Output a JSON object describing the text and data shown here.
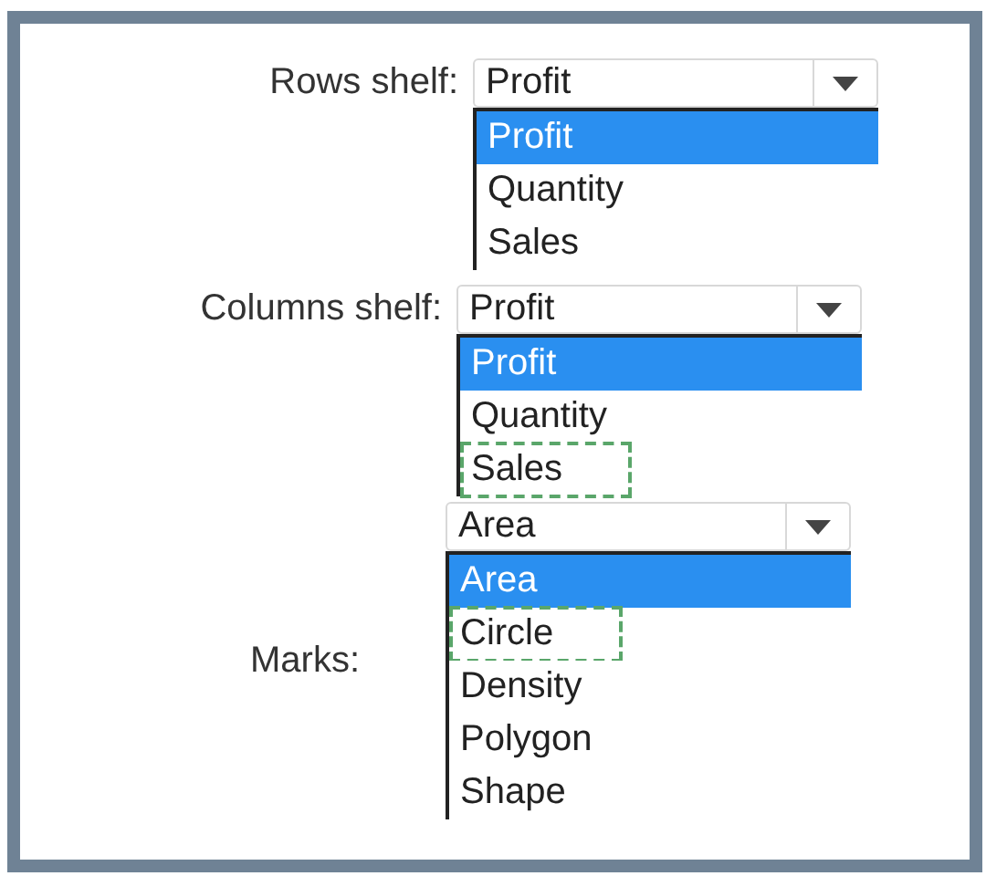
{
  "groups": [
    {
      "label": "Rows shelf:",
      "value": "Profit",
      "options": [
        {
          "label": "Profit",
          "selected": true,
          "marked": false
        },
        {
          "label": "Quantity",
          "selected": false,
          "marked": false
        },
        {
          "label": "Sales",
          "selected": false,
          "marked": false
        }
      ]
    },
    {
      "label": "Columns shelf:",
      "value": "Profit",
      "options": [
        {
          "label": "Profit",
          "selected": true,
          "marked": false
        },
        {
          "label": "Quantity",
          "selected": false,
          "marked": false
        },
        {
          "label": "Sales",
          "selected": false,
          "marked": true
        }
      ]
    },
    {
      "label": "Marks:",
      "value": "Area",
      "options": [
        {
          "label": "Area",
          "selected": true,
          "marked": false
        },
        {
          "label": "Circle",
          "selected": false,
          "marked": true
        },
        {
          "label": "Density",
          "selected": false,
          "marked": false
        },
        {
          "label": "Polygon",
          "selected": false,
          "marked": false
        },
        {
          "label": "Shape",
          "selected": false,
          "marked": false
        }
      ]
    }
  ]
}
